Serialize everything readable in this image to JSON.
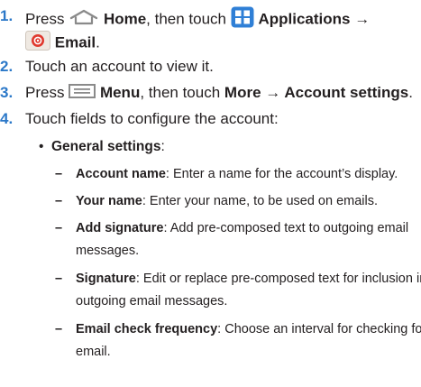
{
  "steps": [
    {
      "number": "1.",
      "line1": {
        "pre": "Press",
        "home_label": "Home",
        "mid": ", then touch",
        "apps_label": "Applications →"
      },
      "line2": {
        "email_label": "Email",
        "end": "."
      }
    },
    {
      "number": "2.",
      "text": "Touch an account to view it."
    },
    {
      "number": "3.",
      "pre": "Press",
      "menu_label": "Menu",
      "mid": ", then touch",
      "path": "More → Account settings",
      "end": "."
    },
    {
      "number": "4.",
      "text": "Touch fields to configure the account:"
    }
  ],
  "general": {
    "bullet": "•",
    "label": "General settings",
    "colon": ":"
  },
  "items": [
    {
      "dash": "–",
      "label": "Account name",
      "desc": ": Enter a name for the account’s display."
    },
    {
      "dash": "–",
      "label": "Your name",
      "desc": ": Enter your name, to be used on emails."
    },
    {
      "dash": "–",
      "label": "Add signature",
      "desc": ": Add pre-composed text to outgoing email",
      "cont": "messages."
    },
    {
      "dash": "–",
      "label": "Signature",
      "desc": ": Edit or replace pre-composed text for inclusion in",
      "cont": "outgoing email messages."
    },
    {
      "dash": "–",
      "label": "Email check frequency",
      "desc": ": Choose an interval for checking for",
      "cont": "email."
    }
  ],
  "colors": {
    "step_number": "#2b78c8",
    "text": "#231f20",
    "icon_gray": "#8a8a8a",
    "apps_blue": "#2f7fd6",
    "email_red": "#e03a2f"
  },
  "icons": {
    "home": "home-icon",
    "applications": "applications-grid-icon",
    "email": "email-app-icon",
    "menu": "menu-icon"
  }
}
